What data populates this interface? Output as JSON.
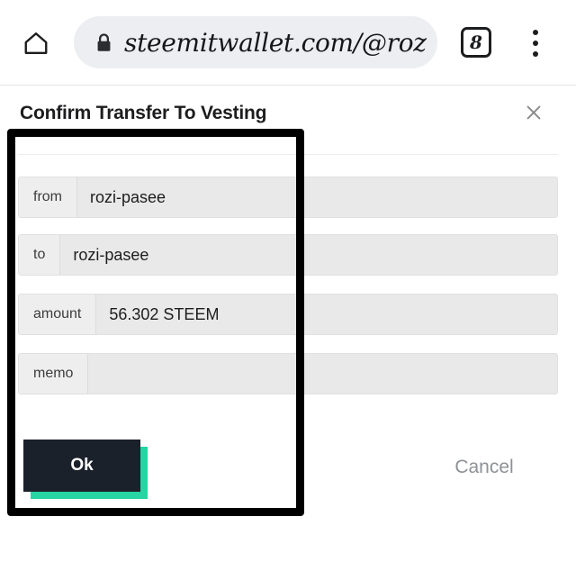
{
  "browser": {
    "home_icon": "home-icon",
    "lock_icon": "lock-icon",
    "url": "steemitwallet.com/@roz",
    "tab_count": "8",
    "menu_icon": "more-vertical-icon"
  },
  "dialog": {
    "title": "Confirm Transfer To Vesting",
    "close_icon": "close-icon",
    "rows": [
      {
        "label": "from",
        "value": "rozi-pasee"
      },
      {
        "label": "to",
        "value": "rozi-pasee"
      },
      {
        "label": "amount",
        "value": "56.302 STEEM"
      },
      {
        "label": "memo",
        "value": ""
      }
    ],
    "ok_label": "Ok",
    "cancel_label": "Cancel"
  },
  "colors": {
    "ok_button_bg": "#1b212b",
    "ok_button_shadow": "#26d4a4",
    "field_bg": "#e9e9e9",
    "label_bg": "#eeeeee",
    "cancel_text": "#8e9196",
    "annotation_border": "#000000"
  }
}
